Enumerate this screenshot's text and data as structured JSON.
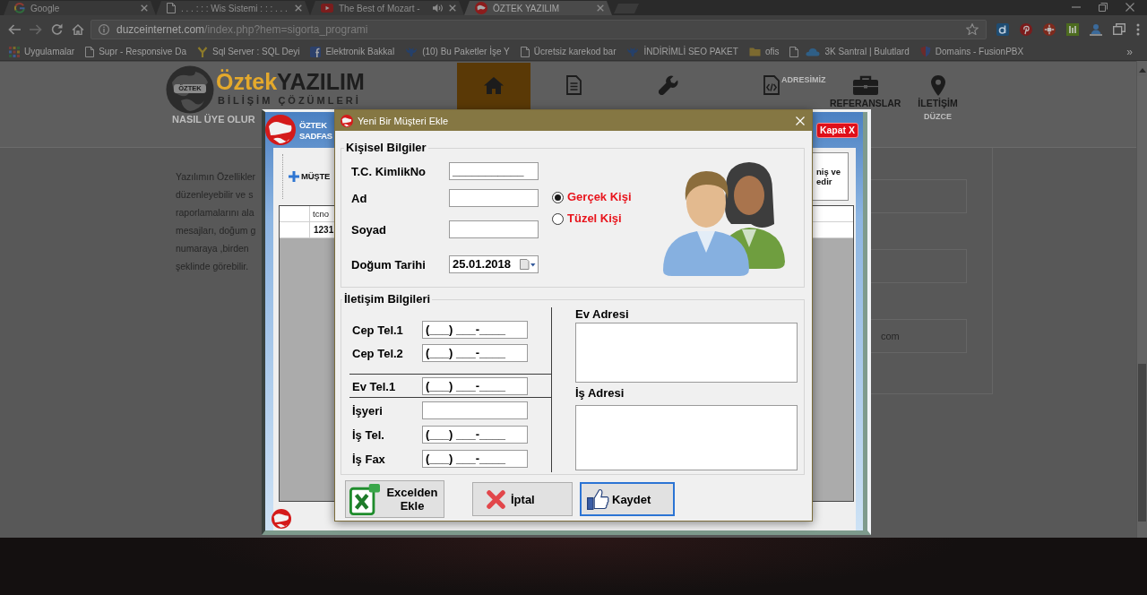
{
  "browser": {
    "tabs": [
      {
        "title": "Google",
        "selected": false,
        "audio": false
      },
      {
        "title": ". . . : : : Wis Sistemi : : : . . .",
        "selected": false,
        "audio": false
      },
      {
        "title": "The Best of Mozart -",
        "selected": false,
        "audio": true
      },
      {
        "title": "ÖZTEK YAZILIM",
        "selected": true,
        "audio": false
      }
    ],
    "address_bar": {
      "url_host": "duzceinternet.com",
      "url_path": "/index.php?hem=sigorta_programi"
    },
    "bookmarks": [
      "Uygulamalar",
      "Supr - Responsive Da",
      "Sql Server : SQL Deyi",
      "Elektronik Bakkal",
      "(10) Bu Paketler İşe Y",
      "Ücretsiz karekod bar",
      "İNDİRİMLİ SEO PAKET",
      "ofis",
      "3K Santral | Bulutlard",
      "Domains - FusionPBX"
    ],
    "bookmarks_more": "»"
  },
  "site": {
    "logo": {
      "badge": "ÖZTEK",
      "brand": "Öztek",
      "product": "YAZILIM",
      "tagline": "BİLİŞİM ÇÖZÜMLERİ"
    },
    "notice": "NASIL ÜYE OLUR",
    "nav": [
      {
        "selected": true
      },
      {
        "selected": false
      },
      {
        "selected": false
      },
      {
        "selected": false
      },
      {
        "selected": false,
        "label": "REFERANSLAR"
      },
      {
        "selected": false,
        "label": "İLETİŞİM",
        "sublabel": "DÜZCE"
      }
    ],
    "nav_hint": "ADRESİMİZ",
    "intro_lines": [
      "Yazılımın Özellikler",
      "düzenleyebilir ve s",
      "raporlamalarını ala",
      "mesajları, doğum g",
      "numaraya ,birden",
      "şeklinde görebilir."
    ],
    "side_box_text": "com"
  },
  "app_window": {
    "header_lines": [
      "ÖZTEK",
      "SADFAS"
    ],
    "close_button": "Kapat X",
    "add_button": "MÜŞTE",
    "note_lines": [
      "niş ve",
      "edir"
    ],
    "grid": {
      "columns": [
        "tcno"
      ],
      "rows": [
        [
          "1231"
        ]
      ]
    }
  },
  "dialog": {
    "title": "Yeni Bir Müşteri Ekle",
    "personal": {
      "legend": "Kişisel Bilgiler",
      "fields": [
        {
          "label": "T.C. KimlikNo",
          "kind": "text",
          "value": "___________"
        },
        {
          "label": "Ad",
          "kind": "text"
        },
        {
          "label": "Soyad",
          "kind": "text"
        },
        {
          "label": "Doğum Tarihi",
          "kind": "date",
          "value": "25.01.2018"
        }
      ],
      "person_type": [
        {
          "label": "Gerçek Kişi",
          "selected": true
        },
        {
          "label": "Tüzel Kişi",
          "selected": false
        }
      ]
    },
    "contact": {
      "legend": "İletişim Bilgileri",
      "phone_groups": [
        [
          {
            "label": "Cep Tel.1",
            "value": "(___) ___-____"
          },
          {
            "label": "Cep Tel.2",
            "value": "(___) ___-____"
          }
        ],
        [
          {
            "label": "Ev Tel.1",
            "value": "(___) ___-____"
          }
        ],
        [
          {
            "label": "İşyeri"
          },
          {
            "label": "İş Tel.",
            "value": "(___) ___-____"
          },
          {
            "label": "İş Fax",
            "value": "(___) ___-____"
          }
        ]
      ],
      "addresses": [
        {
          "label": "Ev Adresi"
        },
        {
          "label": "İş Adresi"
        }
      ]
    },
    "buttons": [
      {
        "label": "Excelden Ekle",
        "focused": false
      },
      {
        "label": "İptal",
        "focused": false
      },
      {
        "label": "Kaydet",
        "focused": true
      }
    ]
  }
}
